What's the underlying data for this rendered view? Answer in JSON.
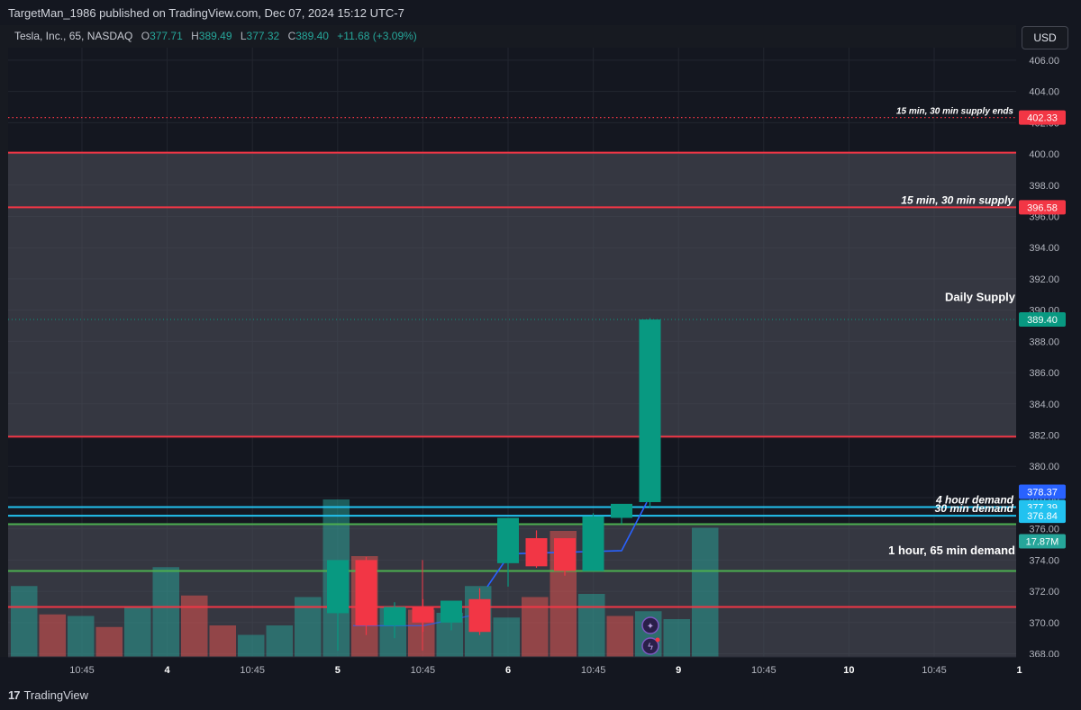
{
  "header": {
    "publish_line": "TargetMan_1986 published on TradingView.com, Dec 07, 2024 15:12 UTC-7"
  },
  "legend": {
    "symbol": "Tesla, Inc., 65, NASDAQ",
    "open_label": "O",
    "open": "377.71",
    "high_label": "H",
    "high": "389.49",
    "low_label": "L",
    "low": "377.32",
    "close_label": "C",
    "close": "389.40",
    "change": "+11.68 (+3.09%)"
  },
  "currency": "USD",
  "footer": {
    "brand": "TradingView",
    "brand_icon": "tradingview-logo-icon"
  },
  "chart_data": {
    "type": "candlestick",
    "ylim": [
      367.8,
      406.8
    ],
    "y_ticks": [
      "368.00",
      "370.00",
      "372.00",
      "374.00",
      "376.00",
      "378.00",
      "380.00",
      "382.00",
      "384.00",
      "386.00",
      "388.00",
      "390.00",
      "392.00",
      "394.00",
      "396.00",
      "398.00",
      "400.00",
      "402.00",
      "404.00",
      "406.00"
    ],
    "x_ticks": [
      "10:45",
      "4",
      "10:45",
      "5",
      "10:45",
      "6",
      "10:45",
      "9",
      "10:45",
      "10",
      "10:45",
      "1"
    ],
    "x_tick_bold": [
      false,
      true,
      false,
      true,
      false,
      true,
      false,
      true,
      false,
      true,
      false,
      true
    ],
    "candles": [
      {
        "o": 370.6,
        "h": 372.4,
        "l": 368.2,
        "c": 374.0
      },
      {
        "o": 374.0,
        "h": 374.2,
        "l": 369.2,
        "c": 369.8
      },
      {
        "o": 369.8,
        "h": 371.3,
        "l": 369.0,
        "c": 371.0
      },
      {
        "o": 371.0,
        "h": 371.5,
        "l": 369.4,
        "c": 370.0
      },
      {
        "o": 370.0,
        "h": 371.3,
        "l": 369.5,
        "c": 371.4
      },
      {
        "o": 371.5,
        "h": 372.2,
        "l": 369.2,
        "c": 369.4
      },
      {
        "o": 373.8,
        "h": 373.9,
        "l": 372.3,
        "c": 376.7
      },
      {
        "o": 375.4,
        "h": 375.9,
        "l": 373.5,
        "c": 373.6
      },
      {
        "o": 375.4,
        "h": 375.4,
        "l": 373.0,
        "c": 373.3
      },
      {
        "o": 373.3,
        "h": 377.0,
        "l": 373.3,
        "c": 376.8
      },
      {
        "o": 376.7,
        "h": 377.5,
        "l": 376.3,
        "c": 377.6
      },
      {
        "o": 377.71,
        "h": 389.49,
        "l": 377.32,
        "c": 389.4
      }
    ],
    "wick_only": [
      {
        "bar_offset": -4.5,
        "h": 374.0,
        "l": 368.2
      }
    ],
    "volume": {
      "label": "17.87M",
      "bars": [
        {
          "v": 0.45,
          "up": true
        },
        {
          "v": 0.27,
          "up": false
        },
        {
          "v": 0.26,
          "up": true
        },
        {
          "v": 0.19,
          "up": false
        },
        {
          "v": 0.32,
          "up": true
        },
        {
          "v": 0.57,
          "up": true
        },
        {
          "v": 0.39,
          "up": false
        },
        {
          "v": 0.2,
          "up": false
        },
        {
          "v": 0.14,
          "up": true
        },
        {
          "v": 0.2,
          "up": true
        },
        {
          "v": 0.38,
          "up": true
        },
        {
          "v": 1.0,
          "up": true
        },
        {
          "v": 0.64,
          "up": false
        },
        {
          "v": 0.32,
          "up": true
        },
        {
          "v": 0.3,
          "up": false
        },
        {
          "v": 0.28,
          "up": true
        },
        {
          "v": 0.45,
          "up": true
        },
        {
          "v": 0.25,
          "up": true
        },
        {
          "v": 0.38,
          "up": false
        },
        {
          "v": 0.8,
          "up": false
        },
        {
          "v": 0.4,
          "up": true
        },
        {
          "v": 0.26,
          "up": false
        },
        {
          "v": 0.29,
          "up": true
        },
        {
          "v": 0.24,
          "up": true
        },
        {
          "v": 0.82,
          "up": true
        }
      ]
    },
    "zones": [
      {
        "top": 400.08,
        "bottom": 381.9,
        "fill": "#50525c"
      },
      {
        "top": 376.3,
        "bottom": 367.8,
        "fill": "#50525c"
      }
    ],
    "levels": [
      {
        "price": 402.33,
        "color": "#f23645",
        "style": "dotted",
        "label": "15 min, 30 min supply ends",
        "italic": true,
        "tag": "402.33",
        "tag_bg": "#f23645"
      },
      {
        "price": 400.08,
        "color": "#f23645",
        "style": "solid"
      },
      {
        "price": 396.58,
        "color": "#f23645",
        "style": "solid",
        "label": "15 min, 30 min supply",
        "italic": true,
        "tag": "396.58",
        "tag_bg": "#f23645"
      },
      {
        "price": 381.9,
        "color": "#f23645",
        "style": "solid"
      },
      {
        "price": 377.39,
        "color": "#22c2f0",
        "style": "solid",
        "label": "4 hour demand",
        "italic": true,
        "tag": "377.39",
        "tag_bg": "#22c2f0"
      },
      {
        "price": 376.84,
        "color": "#22c2f0",
        "style": "solid",
        "label": "30 min demand",
        "italic": true,
        "tag": "376.84",
        "tag_bg": "#22c2f0"
      },
      {
        "price": 376.3,
        "color": "#4caf50",
        "style": "solid"
      },
      {
        "price": 373.3,
        "color": "#4caf50",
        "style": "solid"
      },
      {
        "price": 371.0,
        "color": "#f23645",
        "style": "solid"
      }
    ],
    "annotations": [
      {
        "text": "Daily Supply",
        "price": 390.8,
        "bold": true
      },
      {
        "text": "1 hour, 65 min demand",
        "price": 374.6,
        "bold": true
      }
    ],
    "price_tags": [
      {
        "text": "389.40",
        "price": 389.4,
        "bg": "#089981"
      },
      {
        "text": "378.37",
        "price": 378.37,
        "bg": "#2962ff"
      }
    ],
    "last_price": 389.4,
    "ma_line": [
      376.0,
      376.9,
      377.3,
      377.7
    ]
  }
}
